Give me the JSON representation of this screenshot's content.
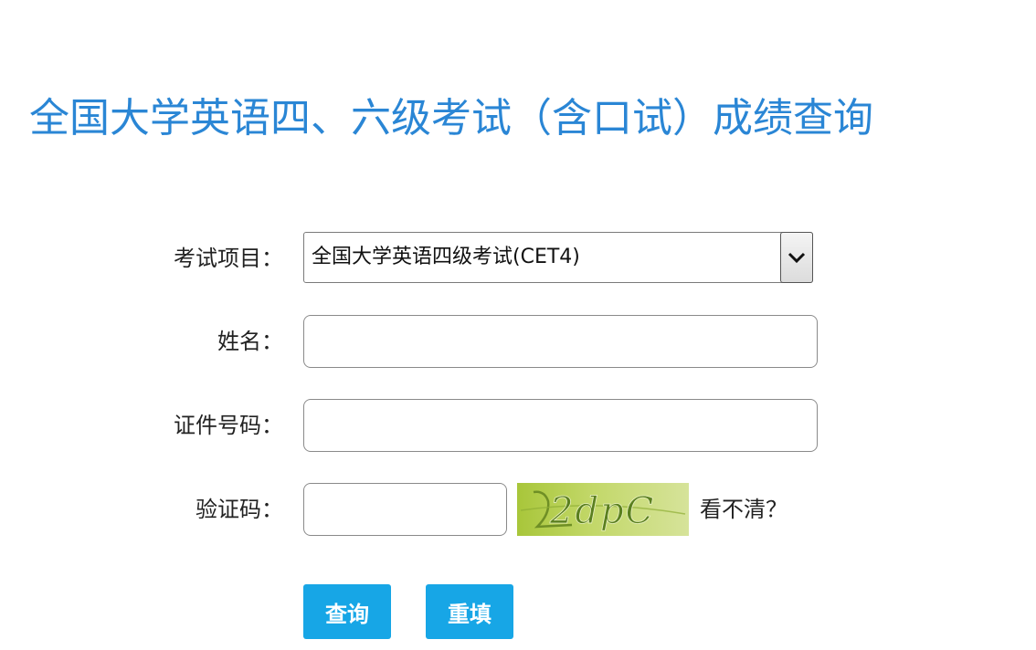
{
  "header": {
    "title": "全国大学英语四、六级考试（含口试）成绩查询"
  },
  "form": {
    "exam_item": {
      "label": "考试项目：",
      "selected_value": "全国大学英语四级考试(CET4)",
      "icon": "chevron-down-icon"
    },
    "name": {
      "label": "姓名：",
      "value": ""
    },
    "id_number": {
      "label": "证件号码：",
      "value": ""
    },
    "captcha": {
      "label": "验证码：",
      "value": "",
      "image_text": "2dpC",
      "refresh_text": "看不清？"
    }
  },
  "actions": {
    "query_label": "查询",
    "reset_label": "重填"
  },
  "colors": {
    "title": "#2a86d5",
    "button": "#17a6e6",
    "captcha_bg": "#b8d055",
    "captcha_text": "#5a7f1f"
  }
}
